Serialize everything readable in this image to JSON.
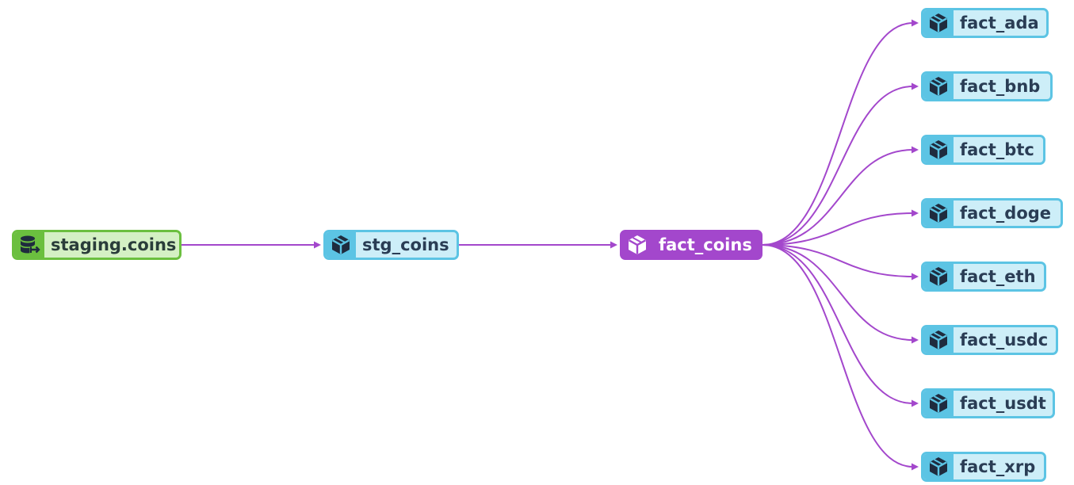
{
  "graph": {
    "nodes": [
      {
        "id": "staging.coins",
        "label": "staging.coins",
        "kind": "source",
        "icon": "database-icon"
      },
      {
        "id": "stg_coins",
        "label": "stg_coins",
        "kind": "model",
        "icon": "cube-icon"
      },
      {
        "id": "fact_coins",
        "label": "fact_coins",
        "kind": "selected",
        "icon": "cube-icon"
      },
      {
        "id": "fact_ada",
        "label": "fact_ada",
        "kind": "model",
        "icon": "cube-icon"
      },
      {
        "id": "fact_bnb",
        "label": "fact_bnb",
        "kind": "model",
        "icon": "cube-icon"
      },
      {
        "id": "fact_btc",
        "label": "fact_btc",
        "kind": "model",
        "icon": "cube-icon"
      },
      {
        "id": "fact_doge",
        "label": "fact_doge",
        "kind": "model",
        "icon": "cube-icon"
      },
      {
        "id": "fact_eth",
        "label": "fact_eth",
        "kind": "model",
        "icon": "cube-icon"
      },
      {
        "id": "fact_usdc",
        "label": "fact_usdc",
        "kind": "model",
        "icon": "cube-icon"
      },
      {
        "id": "fact_usdt",
        "label": "fact_usdt",
        "kind": "model",
        "icon": "cube-icon"
      },
      {
        "id": "fact_xrp",
        "label": "fact_xrp",
        "kind": "model",
        "icon": "cube-icon"
      }
    ],
    "edges": [
      {
        "from": "staging.coins",
        "to": "stg_coins"
      },
      {
        "from": "stg_coins",
        "to": "fact_coins"
      },
      {
        "from": "fact_coins",
        "to": "fact_ada"
      },
      {
        "from": "fact_coins",
        "to": "fact_bnb"
      },
      {
        "from": "fact_coins",
        "to": "fact_btc"
      },
      {
        "from": "fact_coins",
        "to": "fact_doge"
      },
      {
        "from": "fact_coins",
        "to": "fact_eth"
      },
      {
        "from": "fact_coins",
        "to": "fact_usdc"
      },
      {
        "from": "fact_coins",
        "to": "fact_usdt"
      },
      {
        "from": "fact_coins",
        "to": "fact_xrp"
      }
    ]
  },
  "colors": {
    "edge": "#a347cc",
    "source_border": "#6bbf3f",
    "model_border": "#5cc4e4",
    "selected": "#a347cc",
    "icon_dark": "#1f2b3e"
  }
}
